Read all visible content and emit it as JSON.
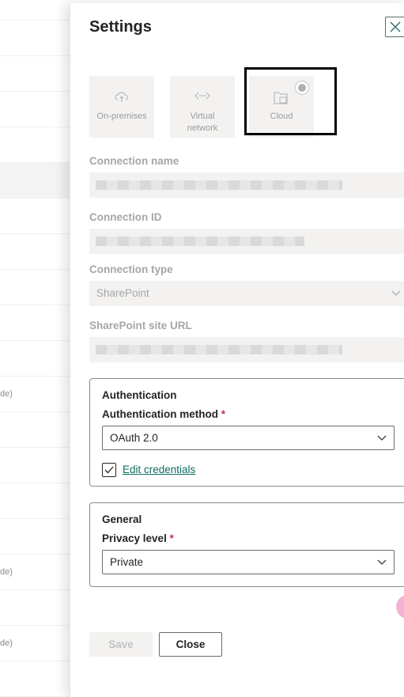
{
  "background": {
    "rows": [
      {
        "text": ""
      },
      {
        "text": ""
      },
      {
        "text": ""
      },
      {
        "text": ""
      },
      {
        "text": ""
      },
      {
        "text": ""
      },
      {
        "text": ""
      },
      {
        "text": ""
      },
      {
        "text": ""
      },
      {
        "text": ""
      },
      {
        "text": "de)"
      },
      {
        "text": ""
      },
      {
        "text": ""
      },
      {
        "text": ""
      },
      {
        "text": ""
      },
      {
        "text": "de)"
      },
      {
        "text": ""
      },
      {
        "text": "de)"
      },
      {
        "text": ""
      }
    ]
  },
  "panel": {
    "title": "Settings",
    "close_icon": "close-icon",
    "gateway_tiles": [
      {
        "label": "On-premises",
        "icon": "cloud-upload-icon"
      },
      {
        "label": "Virtual network",
        "icon": "virtual-network-icon"
      },
      {
        "label": "Cloud",
        "icon": "cloud-folder-icon",
        "selected": true
      }
    ],
    "fields": {
      "connection_name_label": "Connection name",
      "connection_id_label": "Connection ID",
      "connection_type_label": "Connection type",
      "connection_type_value": "SharePoint",
      "site_url_label": "SharePoint site URL"
    },
    "authentication": {
      "title": "Authentication",
      "method_label": "Authentication method",
      "required_mark": "*",
      "method_value": "OAuth 2.0",
      "edit_credentials_label": "Edit credentials",
      "edit_credentials_checked": true
    },
    "general": {
      "title": "General",
      "privacy_label": "Privacy level",
      "required_mark": "*",
      "privacy_value": "Private"
    },
    "buttons": {
      "save": "Save",
      "close": "Close"
    }
  }
}
